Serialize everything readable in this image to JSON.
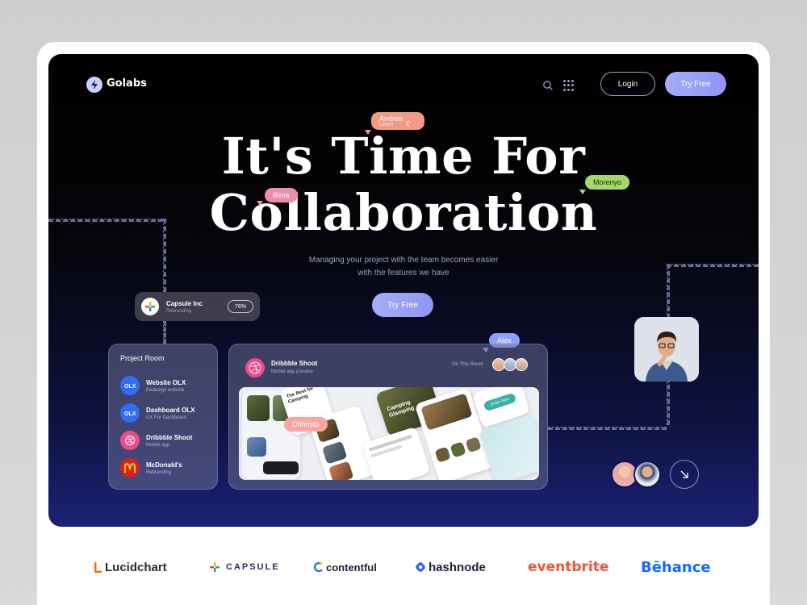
{
  "nav": {
    "brand": "Golabs",
    "login_label": "Login",
    "try_label": "Try Free"
  },
  "hero": {
    "headline_line1": "It's Time For",
    "headline_line2": "Collaboration",
    "subtitle_line1": "Managing your project with the team becomes easier",
    "subtitle_line2": "with the features we have",
    "cta_label": "Try Free"
  },
  "name_tags": {
    "andrea": "Andrea",
    "andrea_sub": "Lorem",
    "morenyo": "Morenyo",
    "bima": "Bima",
    "alex": "Alex",
    "christo": "Chhristo"
  },
  "capsule_card": {
    "name": "Capsule Inc",
    "sub": "Rebranding",
    "progress_label": "76%",
    "progress": 0.76
  },
  "project_room": {
    "title": "Project Room",
    "items": [
      {
        "name": "Website OLX",
        "sub": "Redesign website",
        "icon": "olx-icon",
        "color": "#2f6df6"
      },
      {
        "name": "Dashboard OLX",
        "sub": "UX For Dashboard",
        "icon": "olx-icon",
        "color": "#2f6df6"
      },
      {
        "name": "Dribbble Shoot",
        "sub": "Mobile app",
        "icon": "dribbble-icon",
        "color": "#ea4c89"
      },
      {
        "name": "McDonald's",
        "sub": "Rebranding",
        "icon": "mcdonalds-icon",
        "color": "#d8211c"
      }
    ]
  },
  "preview_panel": {
    "name": "Dribbble Shoot",
    "sub": "Mobile app preview",
    "room_label": "On This Room"
  },
  "preview_texts": {
    "best_for": "The Best for Camping",
    "glamping": "Camping Glamping",
    "order_btn": "Order Now"
  },
  "brands": [
    "Lucidchart",
    "CAPSULE",
    "contentful",
    "hashnode",
    "eventbrite",
    "Bēhance"
  ],
  "colors": {
    "accent": "#9aa4f7",
    "dribbble": "#ea4c89",
    "eventbrite": "#f05537",
    "behance": "#1769ff",
    "hashnode": "#2962ff"
  }
}
